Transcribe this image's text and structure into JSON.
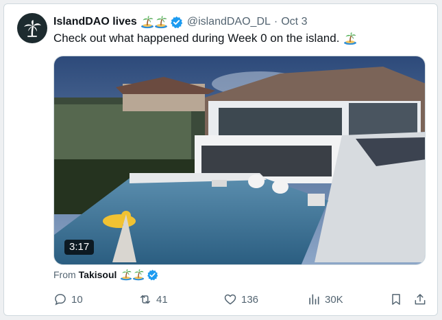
{
  "tweet": {
    "author_name": "IslandDAO lives",
    "handle": "@islandDAO_DL",
    "separator": "·",
    "date": "Oct 3",
    "text": "Check out what happened during Week 0 on the island.",
    "verified_color": "#1d9bf0"
  },
  "media": {
    "type": "video",
    "duration": "3:17"
  },
  "source": {
    "prefix": "From",
    "name": "Takisoul"
  },
  "actions": {
    "replies": "10",
    "retweets": "41",
    "likes": "136",
    "views": "30K"
  },
  "icons": {
    "reply": "reply-icon",
    "retweet": "retweet-icon",
    "like": "heart-icon",
    "views": "views-icon",
    "bookmark": "bookmark-icon",
    "share": "share-icon"
  }
}
